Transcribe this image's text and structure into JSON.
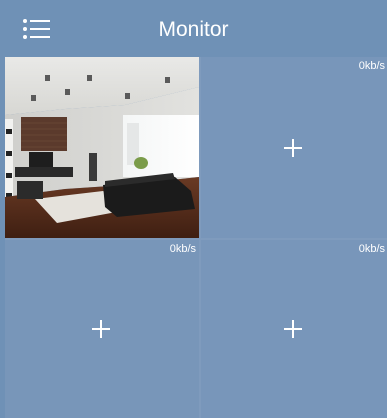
{
  "header": {
    "title": "Monitor",
    "menu_icon": "list-menu-icon"
  },
  "colors": {
    "header_bg": "#6f91b6",
    "cell_bg": "#7896b9",
    "divider": "#7f9bbd",
    "text": "#ffffff"
  },
  "channels": [
    {
      "speed": "",
      "state": "live-preview",
      "icon": "camera-snapshot"
    },
    {
      "speed": "0kb/s",
      "state": "empty",
      "icon": "plus-icon"
    },
    {
      "speed": "0kb/s",
      "state": "empty",
      "icon": "plus-icon"
    },
    {
      "speed": "0kb/s",
      "state": "empty",
      "icon": "plus-icon"
    }
  ]
}
